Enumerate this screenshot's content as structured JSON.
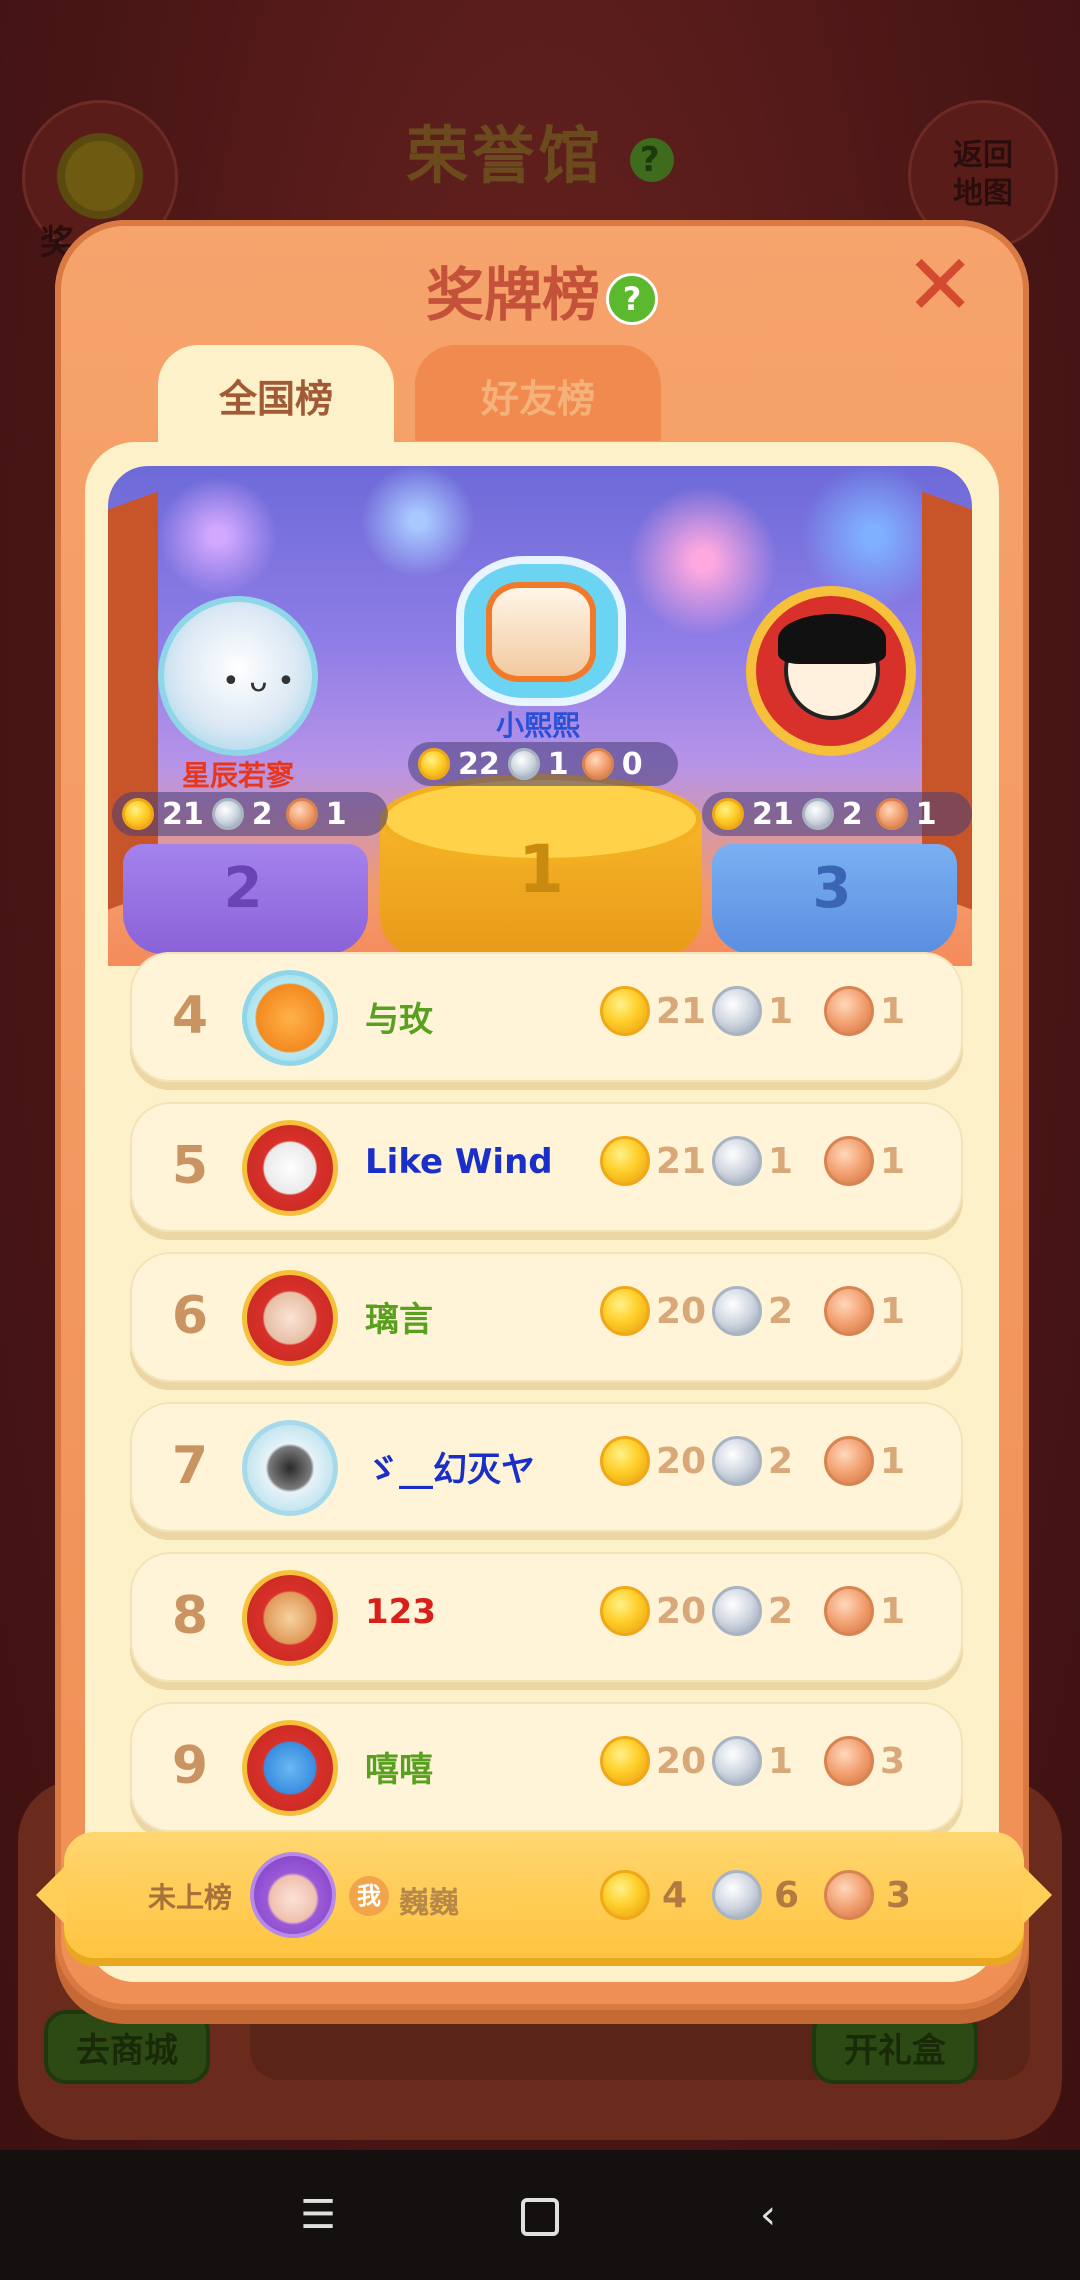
{
  "background": {
    "title": "荣誉馆",
    "help_icon": "question-icon",
    "left_button_label": "奖",
    "right_button_label": "返回地图",
    "shop_button": "去商城",
    "gift_button": "开礼盒"
  },
  "modal": {
    "title": "奖牌榜",
    "help_icon": "question-icon",
    "close_icon": "close-icon",
    "tabs": [
      {
        "label": "全国榜",
        "active": true
      },
      {
        "label": "好友榜",
        "active": false
      }
    ]
  },
  "podium": [
    {
      "rank": "1",
      "name": "小熙熙",
      "gold": "22",
      "silver": "1",
      "bronze": "0"
    },
    {
      "rank": "2",
      "name": "星辰若寥",
      "gold": "21",
      "silver": "2",
      "bronze": "1"
    },
    {
      "rank": "3",
      "name": "",
      "gold": "21",
      "silver": "2",
      "bronze": "1"
    }
  ],
  "rows": [
    {
      "rank": "4",
      "name": "与玫",
      "name_color": "#5aa020",
      "gold": "21",
      "silver": "1",
      "bronze": "1"
    },
    {
      "rank": "5",
      "name": "Like Wind",
      "name_color": "#1a2ec8",
      "gold": "21",
      "silver": "1",
      "bronze": "1"
    },
    {
      "rank": "6",
      "name": "璃言",
      "name_color": "#5aa020",
      "gold": "20",
      "silver": "2",
      "bronze": "1"
    },
    {
      "rank": "7",
      "name": "ゞ__幻灭ヤ",
      "name_color": "#1a2ec8",
      "gold": "20",
      "silver": "2",
      "bronze": "1"
    },
    {
      "rank": "8",
      "name": "123",
      "name_color": "#d8201a",
      "gold": "20",
      "silver": "2",
      "bronze": "1"
    },
    {
      "rank": "9",
      "name": "嘻嘻",
      "name_color": "#5aa020",
      "gold": "20",
      "silver": "1",
      "bronze": "3"
    }
  ],
  "me": {
    "status_label": "未上榜",
    "me_tag": "我",
    "name": "巍巍",
    "gold": "4",
    "silver": "6",
    "bronze": "3"
  },
  "colors": {
    "modal_orange": "#f6a36c",
    "panel_cream": "#fdf1c9",
    "title_red": "#c4523a",
    "gold": "#ffcf2a",
    "silver": "#cfd6e0",
    "bronze": "#f2a070"
  },
  "navbar": {
    "menu_icon": "menu-icon",
    "home_icon": "home-icon",
    "back_icon": "back-icon"
  }
}
